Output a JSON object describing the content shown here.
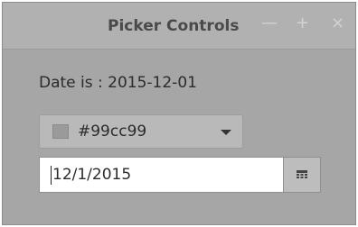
{
  "window": {
    "title": "Picker Controls",
    "minimize_glyph": "—",
    "maximize_glyph": "+",
    "close_glyph": "×"
  },
  "content": {
    "date_label": "Date is : 2015-12-01",
    "color_picker": {
      "value": "#99cc99",
      "swatch_color": "#9a9a9a"
    },
    "date_picker": {
      "value": "12/1/2015",
      "button_icon": "calendar-icon"
    }
  }
}
